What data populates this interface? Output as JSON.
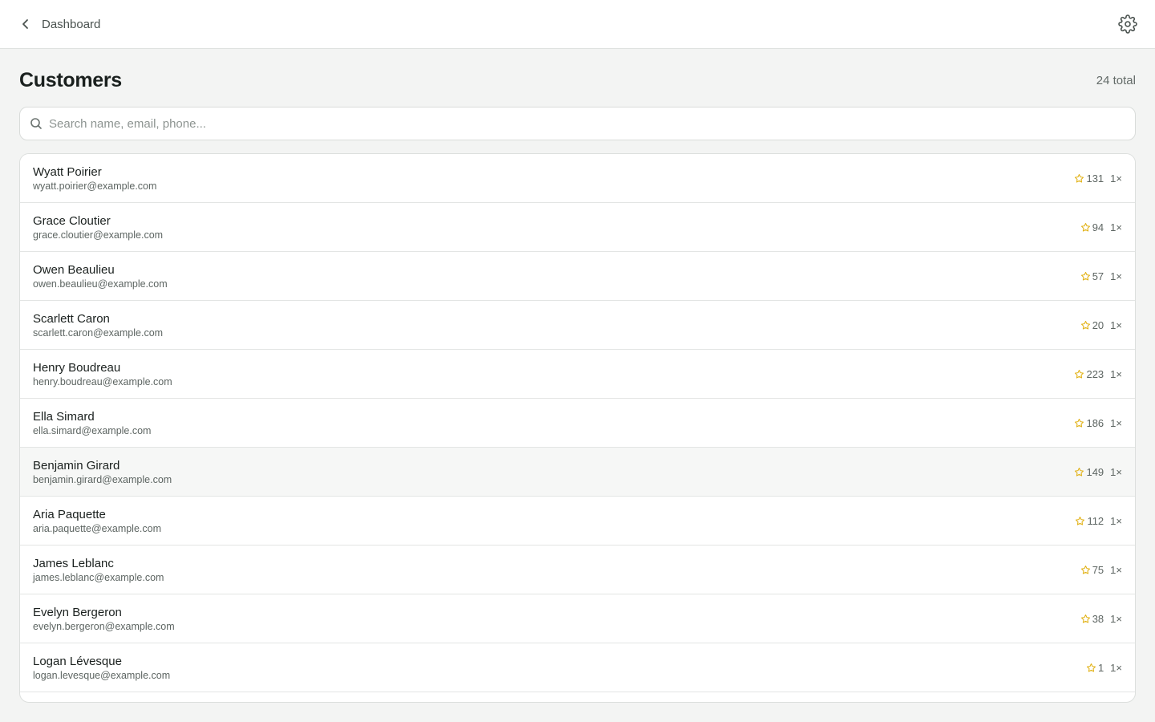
{
  "header": {
    "back_label": "Dashboard"
  },
  "page": {
    "title": "Customers",
    "total": "24 total"
  },
  "search": {
    "placeholder": "Search name, email, phone...",
    "value": ""
  },
  "colors": {
    "star": "#e2b31a",
    "accent_bg": "#f3f4f3"
  },
  "customers": [
    {
      "name": "Wyatt Poirier",
      "email": "wyatt.poirier@example.com",
      "points": "131",
      "visits": "1×"
    },
    {
      "name": "Grace Cloutier",
      "email": "grace.cloutier@example.com",
      "points": "94",
      "visits": "1×"
    },
    {
      "name": "Owen Beaulieu",
      "email": "owen.beaulieu@example.com",
      "points": "57",
      "visits": "1×"
    },
    {
      "name": "Scarlett Caron",
      "email": "scarlett.caron@example.com",
      "points": "20",
      "visits": "1×"
    },
    {
      "name": "Henry Boudreau",
      "email": "henry.boudreau@example.com",
      "points": "223",
      "visits": "1×"
    },
    {
      "name": "Ella Simard",
      "email": "ella.simard@example.com",
      "points": "186",
      "visits": "1×"
    },
    {
      "name": "Benjamin Girard",
      "email": "benjamin.girard@example.com",
      "points": "149",
      "visits": "1×"
    },
    {
      "name": "Aria Paquette",
      "email": "aria.paquette@example.com",
      "points": "112",
      "visits": "1×"
    },
    {
      "name": "James Leblanc",
      "email": "james.leblanc@example.com",
      "points": "75",
      "visits": "1×"
    },
    {
      "name": "Evelyn Bergeron",
      "email": "evelyn.bergeron@example.com",
      "points": "38",
      "visits": "1×"
    },
    {
      "name": "Logan Lévesque",
      "email": "logan.levesque@example.com",
      "points": "1",
      "visits": "1×"
    }
  ]
}
